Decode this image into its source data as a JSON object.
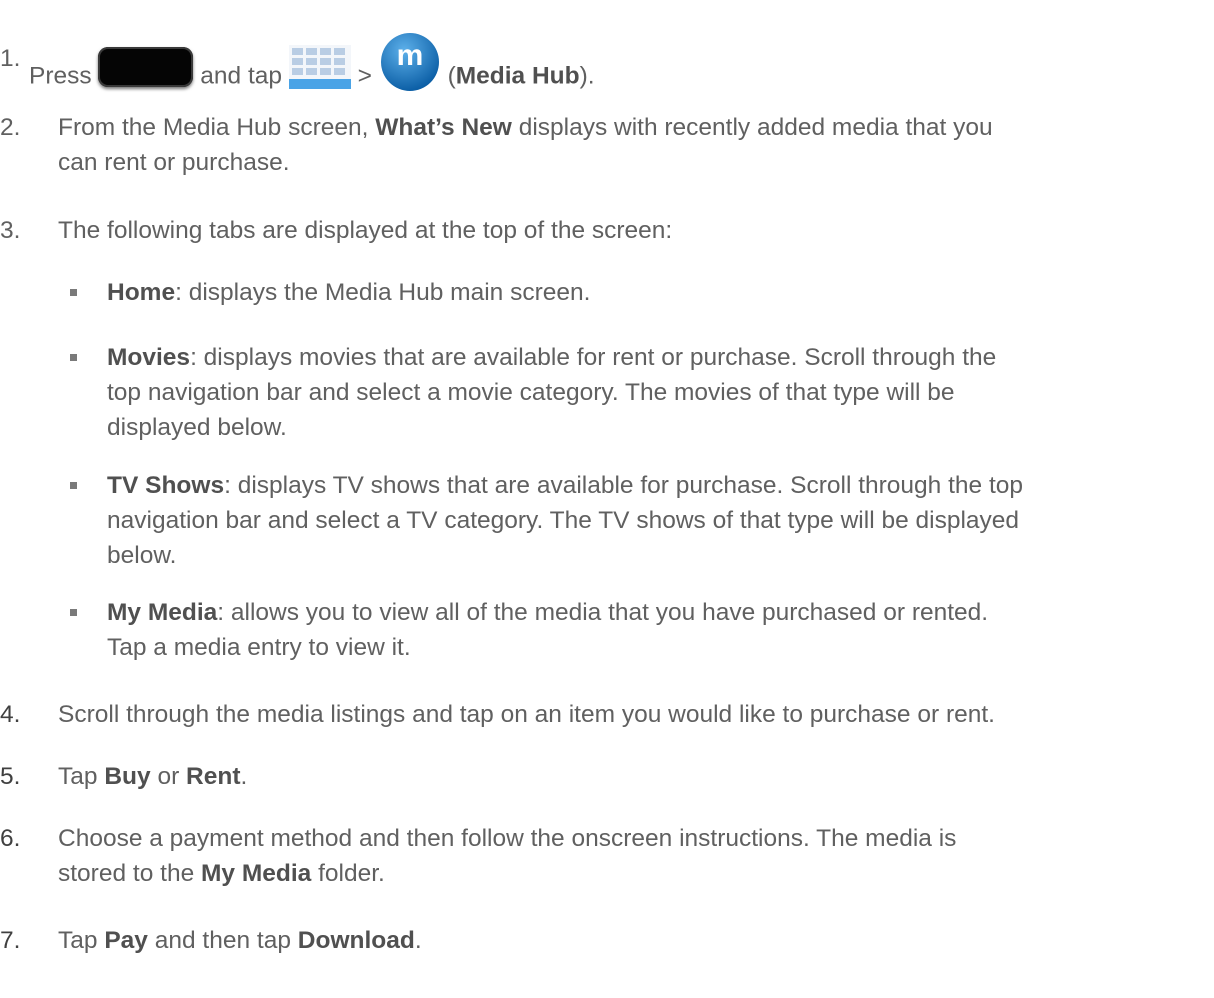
{
  "steps": [
    {
      "num": "1.",
      "press": "Press",
      "and_tap": "and tap",
      "gt": ">",
      "open_paren": "(",
      "media_hub": "Media Hub",
      "close": ")."
    },
    {
      "num": "2.",
      "pre": "From the Media Hub screen,",
      "whats_new": "What’s New",
      "post": "displays with recently added media that you",
      "line2": "can rent or purchase."
    },
    {
      "num": "3.",
      "text": "The following tabs are displayed at the top of the screen:"
    },
    {
      "num": "4.",
      "text": "Scroll through the media listings and tap on an item you would like to purchase or rent."
    },
    {
      "num": "5.",
      "tap": "Tap",
      "buy": "Buy",
      "or": "or",
      "rent": "Rent",
      "dot": "."
    },
    {
      "num": "6.",
      "line1": "Choose a payment method and then follow the onscreen instructions. The media is",
      "line2_pre": "stored to the",
      "my_media": "My Media",
      "line2_post": "folder."
    },
    {
      "num": "7.",
      "tap": "Tap",
      "pay": "Pay",
      "and_then": "and then tap",
      "download": "Download",
      "dot": "."
    }
  ],
  "tabs": [
    {
      "name": "Home",
      "lines": [
        ": displays the Media Hub main screen."
      ]
    },
    {
      "name": "Movies",
      "lines": [
        ": displays movies that are available for rent or purchase. Scroll through the",
        "top navigation bar and select a movie category. The movies of that type will be",
        "displayed below."
      ]
    },
    {
      "name": "TV Shows",
      "lines": [
        ": displays TV shows that are available for purchase. Scroll through the top",
        "navigation bar and select a TV category. The TV shows of that type will be displayed",
        "below."
      ]
    },
    {
      "name": "My Media",
      "lines": [
        ": allows you to view all of the media that you have purchased or rented.",
        "Tap a media entry to view it."
      ]
    }
  ],
  "icons": {
    "home_key": "home-key-icon",
    "apps": "apps-grid-icon",
    "media_hub": "media-hub-icon",
    "media_hub_letter": "m",
    "media_hub_color": "#1a78c2"
  }
}
